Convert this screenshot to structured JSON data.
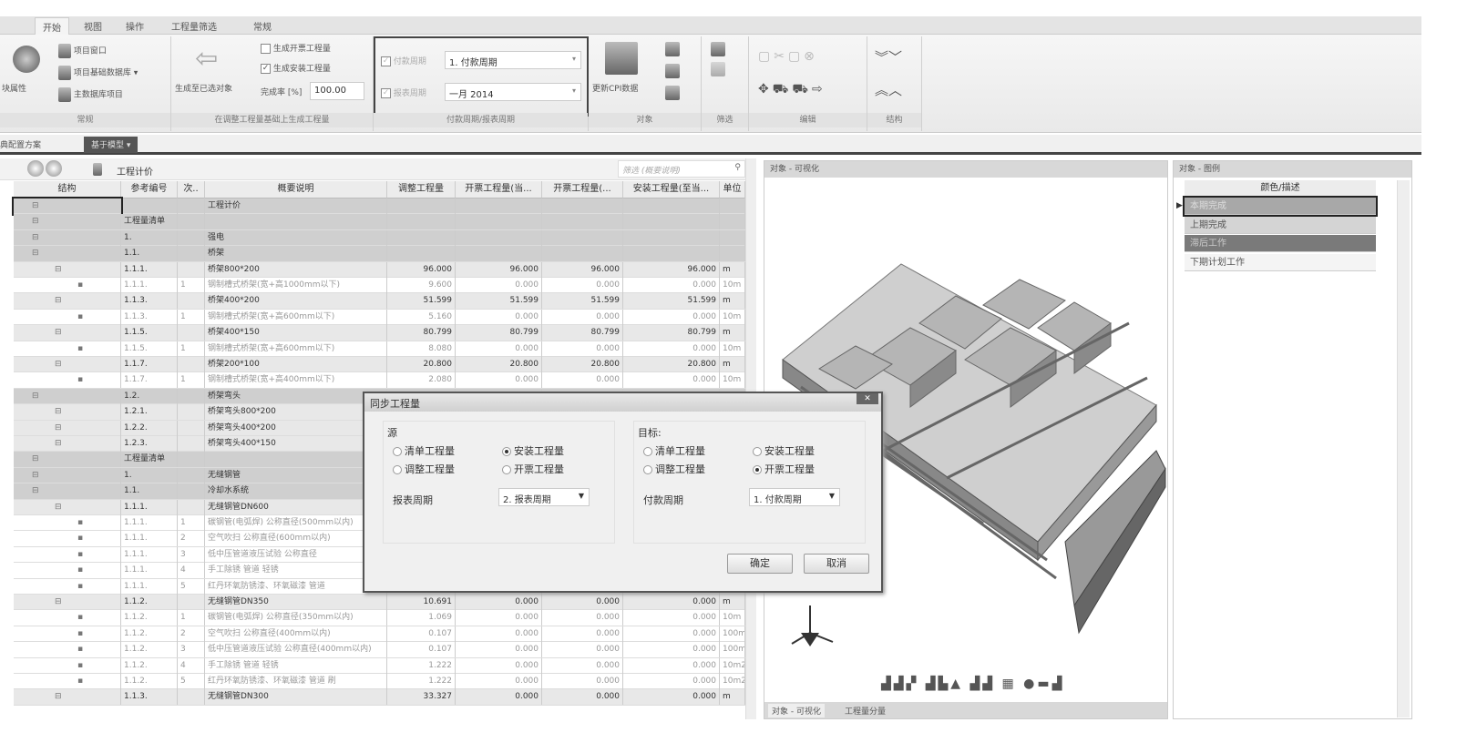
{
  "ribbon": {
    "tabs": [
      "开始",
      "视图",
      "操作",
      "工程量筛选",
      "常规"
    ],
    "group_general": {
      "label": "常规",
      "block_props": "块属性",
      "items": [
        "项目窗口",
        "项目基础数据库",
        "主数据库项目"
      ]
    },
    "group_generate": {
      "label": "在调整工程量基础上生成工程量",
      "gen_selected": "生成至已选对象",
      "gen_invoice": "生成开票工程量",
      "gen_invoice_checked": false,
      "gen_install": "生成安装工程量",
      "gen_install_checked": true,
      "completion_label": "完成率 [%]",
      "completion_value": "100.00"
    },
    "group_period": {
      "label": "付款周期/报表周期",
      "payment_label": "付款周期",
      "payment_value": "1. 付款周期",
      "report_label": "报表周期",
      "report_value": "一月 2014"
    },
    "group_object": {
      "label": "对象",
      "update_cpi": "更新CPI数据"
    },
    "group_filter": {
      "label": "筛选"
    },
    "group_edit": {
      "label": "编辑"
    },
    "group_structure": {
      "label": "结构"
    }
  },
  "doc_tabs": [
    "典配置方案",
    "基于模型"
  ],
  "grid": {
    "breadcrumb": "工程计价",
    "search_placeholder": "筛选 (概要说明)",
    "columns": [
      "结构",
      "参考编号",
      "次..",
      "概要说明",
      "调整工程量",
      "开票工程量(当...",
      "开票工程量(...",
      "安装工程量(至当...",
      "单位"
    ],
    "rows": [
      {
        "lvl": "g1",
        "ref": "",
        "sub": "",
        "desc": "工程计价",
        "v": [
          "",
          "",
          "",
          ""
        ],
        "unit": ""
      },
      {
        "lvl": "g1",
        "ref": "工程量清单",
        "sub": "",
        "desc": "",
        "v": [
          "",
          "",
          "",
          ""
        ],
        "unit": ""
      },
      {
        "lvl": "g1",
        "ref": "1.",
        "sub": "",
        "desc": "强电",
        "v": [
          "",
          "",
          "",
          ""
        ],
        "unit": ""
      },
      {
        "lvl": "g1",
        "ref": "1.1.",
        "sub": "",
        "desc": "桥架",
        "v": [
          "",
          "",
          "",
          ""
        ],
        "unit": ""
      },
      {
        "lvl": "g2",
        "ref": "1.1.1.",
        "sub": "",
        "desc": "桥架800*200",
        "v": [
          "96.000",
          "96.000",
          "96.000",
          "96.000"
        ],
        "unit": "m"
      },
      {
        "lvl": "g3",
        "ref": "1.1.1.",
        "sub": "1",
        "desc": "钢制槽式桥架(宽+高1000mm以下)",
        "v": [
          "9.600",
          "0.000",
          "0.000",
          "0.000"
        ],
        "unit": "10m"
      },
      {
        "lvl": "g2",
        "ref": "1.1.3.",
        "sub": "",
        "desc": "桥架400*200",
        "v": [
          "51.599",
          "51.599",
          "51.599",
          "51.599"
        ],
        "unit": "m"
      },
      {
        "lvl": "g3",
        "ref": "1.1.3.",
        "sub": "1",
        "desc": "钢制槽式桥架(宽+高600mm以下)",
        "v": [
          "5.160",
          "0.000",
          "0.000",
          "0.000"
        ],
        "unit": "10m"
      },
      {
        "lvl": "g2",
        "ref": "1.1.5.",
        "sub": "",
        "desc": "桥架400*150",
        "v": [
          "80.799",
          "80.799",
          "80.799",
          "80.799"
        ],
        "unit": "m"
      },
      {
        "lvl": "g3",
        "ref": "1.1.5.",
        "sub": "1",
        "desc": "钢制槽式桥架(宽+高600mm以下)",
        "v": [
          "8.080",
          "0.000",
          "0.000",
          "0.000"
        ],
        "unit": "10m"
      },
      {
        "lvl": "g2",
        "ref": "1.1.7.",
        "sub": "",
        "desc": "桥架200*100",
        "v": [
          "20.800",
          "20.800",
          "20.800",
          "20.800"
        ],
        "unit": "m"
      },
      {
        "lvl": "g3",
        "ref": "1.1.7.",
        "sub": "1",
        "desc": "钢制槽式桥架(宽+高400mm以下)",
        "v": [
          "2.080",
          "0.000",
          "0.000",
          "0.000"
        ],
        "unit": "10m"
      },
      {
        "lvl": "g1",
        "ref": "1.2.",
        "sub": "",
        "desc": "桥架弯头",
        "v": [
          "",
          "",
          "",
          ""
        ],
        "unit": ""
      },
      {
        "lvl": "g2",
        "ref": "1.2.1.",
        "sub": "",
        "desc": "桥架弯头800*200",
        "v": [
          "",
          "",
          "",
          ""
        ],
        "unit": ""
      },
      {
        "lvl": "g2",
        "ref": "1.2.2.",
        "sub": "",
        "desc": "桥架弯头400*200",
        "v": [
          "",
          "",
          "",
          ""
        ],
        "unit": ""
      },
      {
        "lvl": "g2",
        "ref": "1.2.3.",
        "sub": "",
        "desc": "桥架弯头400*150",
        "v": [
          "",
          "",
          "",
          ""
        ],
        "unit": ""
      },
      {
        "lvl": "g1",
        "ref": "工程量清单",
        "sub": "",
        "desc": "",
        "v": [
          "",
          "",
          "",
          ""
        ],
        "unit": ""
      },
      {
        "lvl": "g1",
        "ref": "1.",
        "sub": "",
        "desc": "无缝钢管",
        "v": [
          "",
          "",
          "",
          ""
        ],
        "unit": ""
      },
      {
        "lvl": "g1",
        "ref": "1.1.",
        "sub": "",
        "desc": "冷却水系统",
        "v": [
          "",
          "",
          "",
          ""
        ],
        "unit": ""
      },
      {
        "lvl": "g2",
        "ref": "1.1.1.",
        "sub": "",
        "desc": "无缝钢管DN600",
        "v": [
          "",
          "",
          "",
          ""
        ],
        "unit": ""
      },
      {
        "lvl": "g3",
        "ref": "1.1.1.",
        "sub": "1",
        "desc": "碳钢管(电弧焊) 公称直径(500mm以内)",
        "v": [
          "",
          "",
          "",
          ""
        ],
        "unit": ""
      },
      {
        "lvl": "g3",
        "ref": "1.1.1.",
        "sub": "2",
        "desc": "空气吹扫 公称直径(600mm以内)",
        "v": [
          "",
          "",
          "",
          ""
        ],
        "unit": ""
      },
      {
        "lvl": "g3",
        "ref": "1.1.1.",
        "sub": "3",
        "desc": "低中压管道液压试验 公称直径",
        "v": [
          "",
          "",
          "",
          ""
        ],
        "unit": ""
      },
      {
        "lvl": "g3",
        "ref": "1.1.1.",
        "sub": "4",
        "desc": "手工除锈 管道 轻锈",
        "v": [
          "",
          "",
          "",
          ""
        ],
        "unit": ""
      },
      {
        "lvl": "g3",
        "ref": "1.1.1.",
        "sub": "5",
        "desc": "红丹环氧防锈漆、环氧磁漆 管道",
        "v": [
          "",
          "",
          "",
          ""
        ],
        "unit": ""
      },
      {
        "lvl": "g2",
        "ref": "1.1.2.",
        "sub": "",
        "desc": "无缝钢管DN350",
        "v": [
          "10.691",
          "0.000",
          "0.000",
          "0.000"
        ],
        "unit": "m"
      },
      {
        "lvl": "g3",
        "ref": "1.1.2.",
        "sub": "1",
        "desc": "碳钢管(电弧焊) 公称直径(350mm以内)",
        "v": [
          "1.069",
          "0.000",
          "0.000",
          "0.000"
        ],
        "unit": "10m"
      },
      {
        "lvl": "g3",
        "ref": "1.1.2.",
        "sub": "2",
        "desc": "空气吹扫 公称直径(400mm以内)",
        "v": [
          "0.107",
          "0.000",
          "0.000",
          "0.000"
        ],
        "unit": "100m"
      },
      {
        "lvl": "g3",
        "ref": "1.1.2.",
        "sub": "3",
        "desc": "低中压管道液压试验 公称直径(400mm以内)",
        "v": [
          "0.107",
          "0.000",
          "0.000",
          "0.000"
        ],
        "unit": "100m"
      },
      {
        "lvl": "g3",
        "ref": "1.1.2.",
        "sub": "4",
        "desc": "手工除锈 管道 轻锈",
        "v": [
          "1.222",
          "0.000",
          "0.000",
          "0.000"
        ],
        "unit": "10m2"
      },
      {
        "lvl": "g3",
        "ref": "1.1.2.",
        "sub": "5",
        "desc": "红丹环氧防锈漆、环氧磁漆 管道 刷",
        "v": [
          "1.222",
          "0.000",
          "0.000",
          "0.000"
        ],
        "unit": "10m2"
      },
      {
        "lvl": "g2",
        "ref": "1.1.3.",
        "sub": "",
        "desc": "无缝钢管DN300",
        "v": [
          "33.327",
          "0.000",
          "0.000",
          "0.000"
        ],
        "unit": "m"
      }
    ]
  },
  "viewport": {
    "title": "对象 - 可视化",
    "tabs": [
      "对象 - 可视化",
      "工程量分量"
    ]
  },
  "legend": {
    "title": "对象 - 图例",
    "header": "颜色/描述",
    "items": [
      {
        "label": "本期完成",
        "color": "#a8a8a8",
        "text": "#ddd"
      },
      {
        "label": "上期完成",
        "color": "#d4d4d4",
        "text": "#555"
      },
      {
        "label": "滞后工作",
        "color": "#7a7a7a",
        "text": "#ccc"
      },
      {
        "label": "下期计划工作",
        "color": "#f4f4f4",
        "text": "#555"
      }
    ]
  },
  "dialog": {
    "title": "同步工程量",
    "source": {
      "label": "源",
      "options": [
        "清单工程量",
        "安装工程量",
        "调整工程量",
        "开票工程量"
      ],
      "selected": "安装工程量",
      "period_label": "报表周期",
      "period_value": "2. 报表周期"
    },
    "target": {
      "label": "目标:",
      "options": [
        "清单工程量",
        "安装工程量",
        "调整工程量",
        "开票工程量"
      ],
      "selected": "开票工程量",
      "period_label": "付款周期",
      "period_value": "1. 付款周期"
    },
    "ok": "确定",
    "cancel": "取消"
  }
}
